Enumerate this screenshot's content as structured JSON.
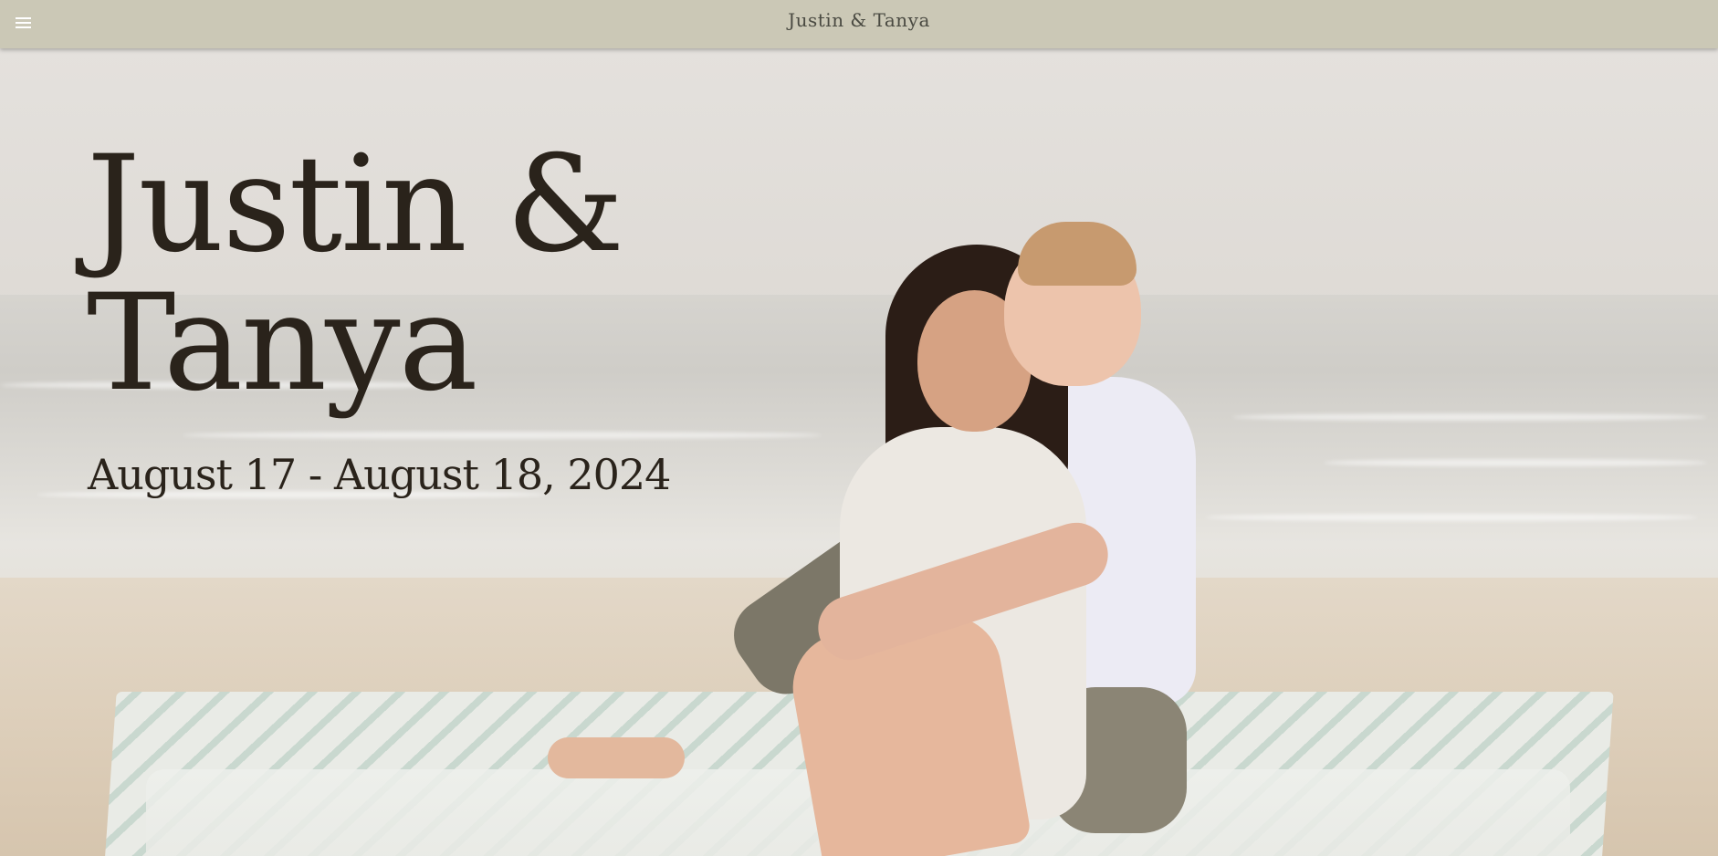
{
  "header": {
    "menu_icon": "hamburger-menu-icon",
    "site_title": "Justin & Tanya",
    "background_color": "#cbc8b6"
  },
  "hero": {
    "heading_line1": "Justin &",
    "heading_line2": "Tanya",
    "dates": "August 17 - August 18, 2024",
    "text_color": "#2a231b",
    "image": "couple-on-beach-photo"
  }
}
